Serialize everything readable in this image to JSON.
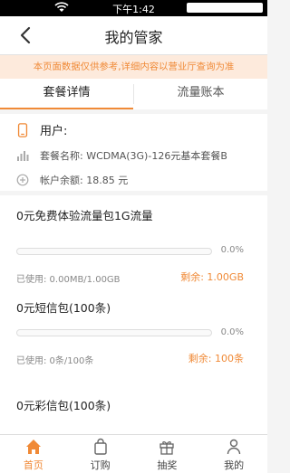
{
  "status_bar": {
    "time": "下午1:42"
  },
  "nav": {
    "title": "我的管家"
  },
  "notice": {
    "text": "本页面数据仅供参考,详细内容以营业厅查询为准"
  },
  "tabs": [
    {
      "label": "套餐详情",
      "active": true
    },
    {
      "label": "流量账本",
      "active": false
    }
  ],
  "user": {
    "phone_label": "用户:",
    "package_label": "套餐名称: WCDMA(3G)-126元基本套餐B",
    "balance_label": "帐户余额: 18.85 元"
  },
  "packages": [
    {
      "name": "0元免费体验流量包1G流量",
      "percent": 0.0,
      "percent_text": "0.0%",
      "used": "已使用: 0.00MB/1.00GB",
      "remain": "剩余: 1.00GB"
    },
    {
      "name": "0元短信包(100条)",
      "percent": 0.0,
      "percent_text": "0.0%",
      "used": "已使用: 0条/100条",
      "remain": "剩余: 100条"
    },
    {
      "name": "0元彩信包(100条)",
      "percent": 0.0,
      "percent_text": "",
      "used": "",
      "remain": ""
    }
  ],
  "bottom_nav": [
    {
      "label": "首页",
      "icon": "home-icon",
      "active": true
    },
    {
      "label": "订购",
      "icon": "bag-icon",
      "active": false
    },
    {
      "label": "抽奖",
      "icon": "gift-icon",
      "active": false
    },
    {
      "label": "我的",
      "icon": "person-icon",
      "active": false
    }
  ],
  "colors": {
    "accent": "#f08a37",
    "notice_bg": "#fdeadc"
  }
}
